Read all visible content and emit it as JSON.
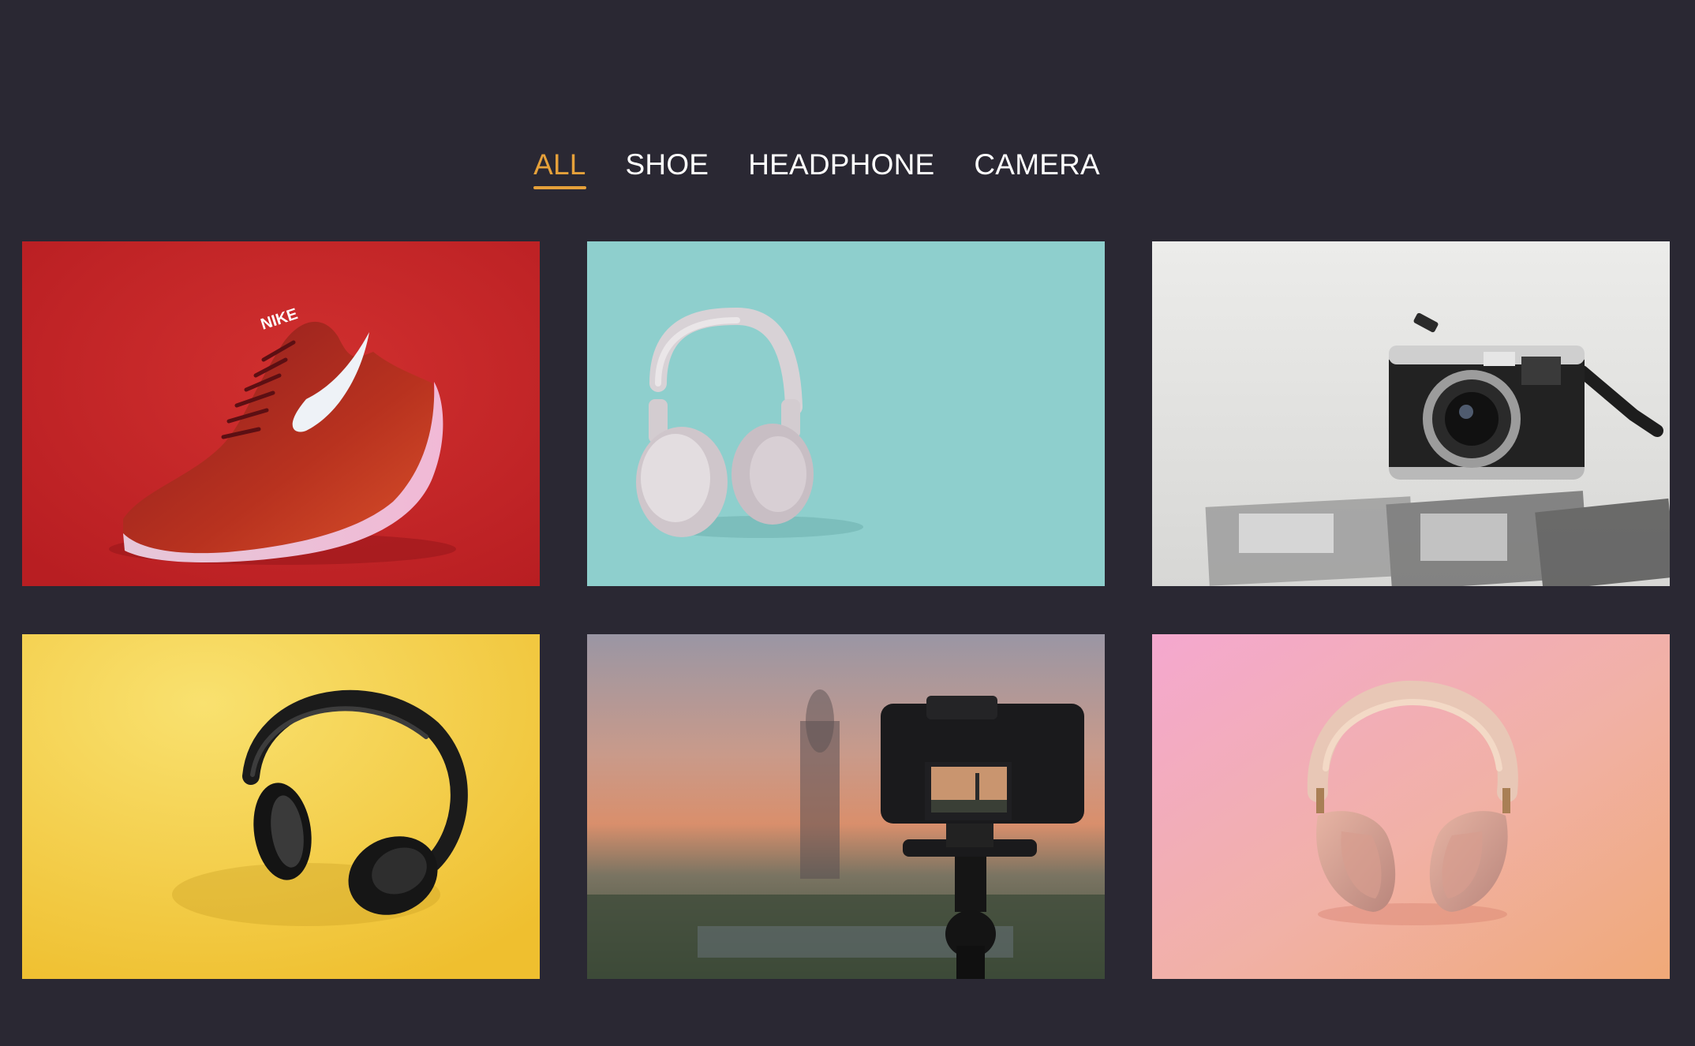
{
  "filters": {
    "all": "ALL",
    "shoe": "SHOE",
    "headphone": "HEADPHONE",
    "camera": "CAMERA",
    "active": "ALL"
  },
  "colors": {
    "background": "#2a2833",
    "accent": "#e6a13a",
    "tab_text": "#ffffff"
  },
  "gallery": {
    "items": [
      {
        "category": "shoe",
        "subject": "red-sneaker",
        "brand_text": "NIKE",
        "backdrop": "#c42427"
      },
      {
        "category": "headphone",
        "subject": "white-headphones",
        "backdrop": "#8ecfcd"
      },
      {
        "category": "camera",
        "subject": "silver-rangefinder-camera",
        "backdrop": "#e4e4e2"
      },
      {
        "category": "headphone",
        "subject": "black-headphones",
        "backdrop": "#f5cf4a"
      },
      {
        "category": "camera",
        "subject": "camera-on-tripod-sunset",
        "backdrop": "#c98a6e"
      },
      {
        "category": "headphone",
        "subject": "pink-over-ear-headphones",
        "backdrop": "#f1a9b8"
      }
    ]
  }
}
